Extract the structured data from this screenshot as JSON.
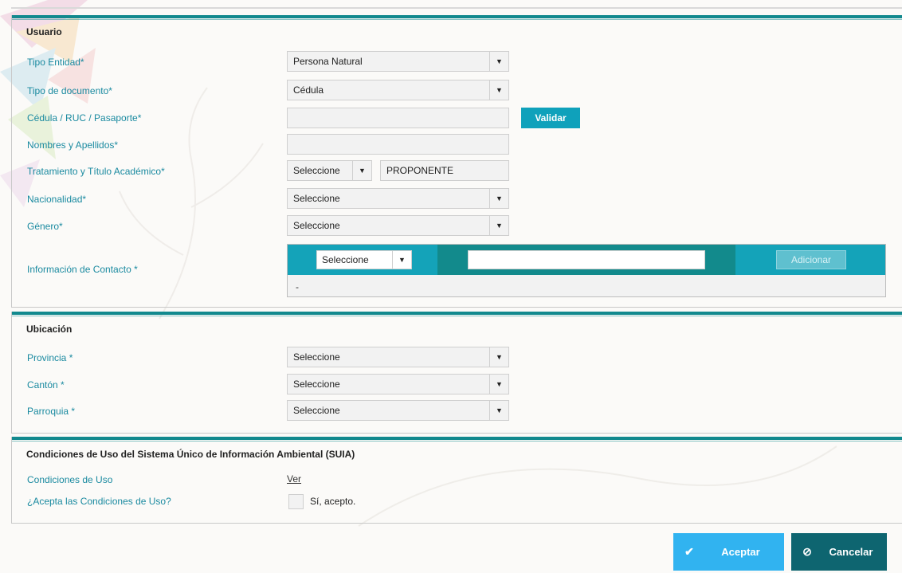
{
  "usuario": {
    "title": "Usuario",
    "tipo_entidad": {
      "label": "Tipo Entidad*",
      "value": "Persona Natural"
    },
    "tipo_documento": {
      "label": "Tipo de documento*",
      "value": "Cédula"
    },
    "cedula": {
      "label": "Cédula / RUC / Pasaporte*",
      "value": "",
      "validar_label": "Validar"
    },
    "nombres": {
      "label": "Nombres y Apellidos*",
      "value": ""
    },
    "tratamiento": {
      "label": "Tratamiento y Título Académico*",
      "select_value": "Seleccione",
      "title_value": "PROPONENTE"
    },
    "nacionalidad": {
      "label": "Nacionalidad*",
      "value": "Seleccione"
    },
    "genero": {
      "label": "Género*",
      "value": "Seleccione"
    },
    "contacto": {
      "label": "Información de Contacto *",
      "select_value": "Seleccione",
      "input_value": "",
      "add_label": "Adicionar",
      "empty_row": "-"
    }
  },
  "ubicacion": {
    "title": "Ubicación",
    "provincia": {
      "label": "Provincia *",
      "value": "Seleccione"
    },
    "canton": {
      "label": "Cantón *",
      "value": "Seleccione"
    },
    "parroquia": {
      "label": "Parroquia *",
      "value": "Seleccione"
    }
  },
  "condiciones": {
    "title": "Condiciones de Uso del Sistema Único de Información Ambiental (SUIA)",
    "condiciones_label": "Condiciones de Uso",
    "ver_link": "Ver",
    "acepta_label": "¿Acepta las Condiciones de Uso?",
    "acepto_text": "Sí, acepto."
  },
  "actions": {
    "aceptar_label": "Aceptar",
    "cancelar_label": "Cancelar"
  },
  "colors": {
    "teal_bar": "#12898e",
    "label_blue": "#1a8aa0",
    "validar_bg": "#0fa1bb",
    "aceptar_bg": "#31b3f0",
    "cancelar_bg": "#0e6570"
  }
}
